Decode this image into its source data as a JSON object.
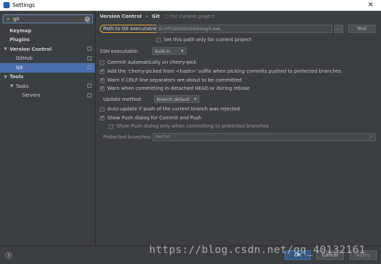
{
  "window": {
    "title": "Settings"
  },
  "sidebar": {
    "search_value": "git",
    "items": [
      {
        "label": "Keymap",
        "bold": true,
        "level": 0
      },
      {
        "label": "Plugins",
        "bold": true,
        "level": 0
      },
      {
        "label": "Version Control",
        "bold": true,
        "level": 0,
        "expanded": true,
        "project": true
      },
      {
        "label": "GitHub",
        "bold": false,
        "level": 1,
        "project": true
      },
      {
        "label": "Git",
        "bold": false,
        "level": 1,
        "project": true,
        "selected": true
      },
      {
        "label": "Tools",
        "bold": true,
        "level": 0,
        "expanded": true
      },
      {
        "label": "Tasks",
        "bold": false,
        "level": 1,
        "expanded": true,
        "project": true
      },
      {
        "label": "Servers",
        "bold": false,
        "level": 2,
        "project": true
      }
    ]
  },
  "main": {
    "breadcrumb": {
      "parent": "Version Control",
      "separator": "›",
      "current": "Git",
      "note": "For current project"
    },
    "path_label": "Path to Git executable:",
    "path_value": "D:\\HY\\Git\\Git\\Git\\bin\\git.exe",
    "dots_label": "...",
    "test_label": "Test",
    "set_path_only": "Set this path only for current project",
    "ssh_label": "SSH executable:",
    "ssh_value": "Built-in",
    "commit_cherry": "Commit automatically on cherry-pick",
    "add_suffix": "Add the 'cherry-picked from <hash>' suffix when picking commits pushed to protected branches",
    "warn_crlf": "Warn if CRLF line separators are about to be committed",
    "warn_detached": "Warn when committing in detached HEAD or during rebase",
    "update_label": "Update method:",
    "update_value": "Branch default",
    "auto_update": "Auto-update if push of the current branch was rejected",
    "show_push": "Show Push dialog for Commit and Push",
    "show_push_protected": "Show Push dialog only when committing to protected branches",
    "protected_label": "Protected branches:",
    "protected_value": "master"
  },
  "footer": {
    "help": "?",
    "ok": "OK",
    "cancel": "Cancel",
    "apply": "Apply"
  },
  "watermark": "https://blog.csdn.net/qq_40132161"
}
